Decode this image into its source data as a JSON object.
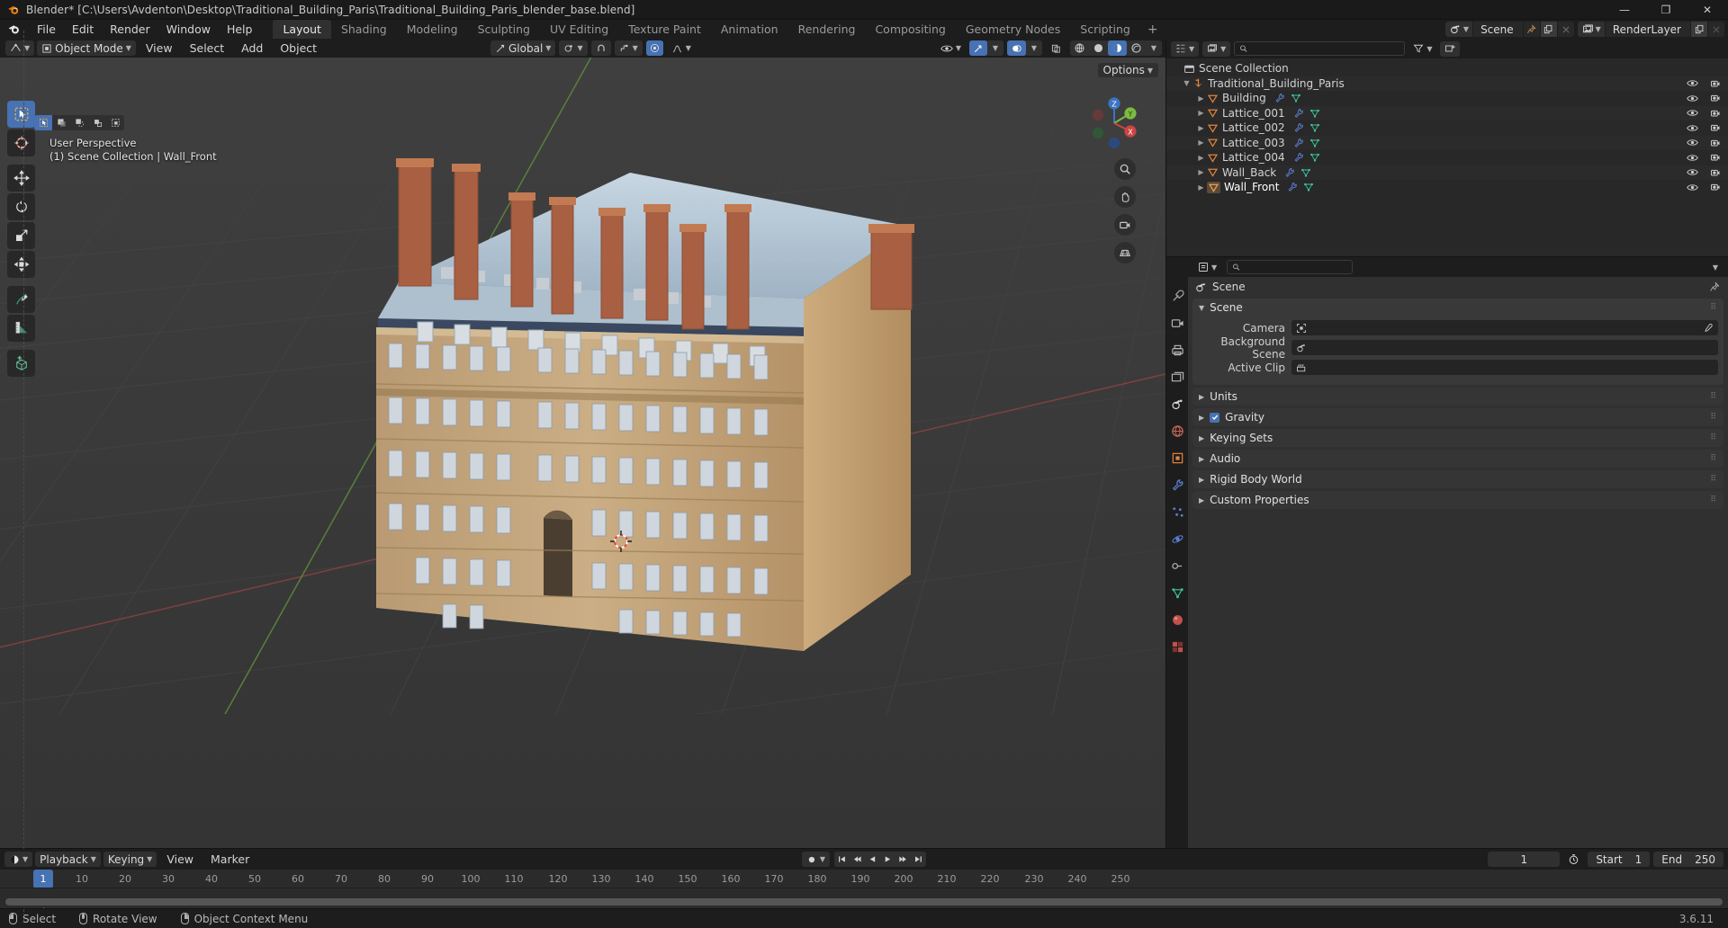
{
  "window": {
    "title": "Blender* [C:\\Users\\Avdenton\\Desktop\\Traditional_Building_Paris\\Traditional_Building_Paris_blender_base.blend]",
    "minimize": "—",
    "maximize": "❐",
    "close": "✕"
  },
  "menu": {
    "items": [
      "File",
      "Edit",
      "Render",
      "Window",
      "Help"
    ]
  },
  "workspace_tabs": {
    "items": [
      "Layout",
      "Shading",
      "Modeling",
      "Sculpting",
      "UV Editing",
      "Texture Paint",
      "Animation",
      "Rendering",
      "Compositing",
      "Geometry Nodes",
      "Scripting"
    ],
    "active": "Layout",
    "add_label": "+"
  },
  "topbar_right": {
    "scene_name": "Scene",
    "viewlayer_name": "RenderLayer"
  },
  "viewport_header": {
    "mode": "Object Mode",
    "menus": [
      "View",
      "Select",
      "Add",
      "Object"
    ],
    "transform_orientation": "Global",
    "options_label": "Options"
  },
  "viewport": {
    "overlay_line1": "User Perspective",
    "overlay_line2": "(1) Scene Collection | Wall_Front",
    "gizmo_axes": {
      "x": "X",
      "y": "Y",
      "z": "Z"
    }
  },
  "outliner": {
    "search_placeholder": "",
    "rows": [
      {
        "label": "Scene Collection",
        "depth": 0,
        "icon": "collection-icon",
        "expander": "",
        "has_mod_icons": false,
        "active": false
      },
      {
        "label": "Traditional_Building_Paris",
        "depth": 1,
        "icon": "collection-instance-icon",
        "expander": "▼",
        "has_mod_icons": false,
        "active": false
      },
      {
        "label": "Building",
        "depth": 2,
        "icon": "mesh-object-icon",
        "expander": "▶",
        "has_mod_icons": true,
        "active": false
      },
      {
        "label": "Lattice_001",
        "depth": 2,
        "icon": "mesh-object-icon",
        "expander": "▶",
        "has_mod_icons": true,
        "active": false
      },
      {
        "label": "Lattice_002",
        "depth": 2,
        "icon": "mesh-object-icon",
        "expander": "▶",
        "has_mod_icons": true,
        "active": false
      },
      {
        "label": "Lattice_003",
        "depth": 2,
        "icon": "mesh-object-icon",
        "expander": "▶",
        "has_mod_icons": true,
        "active": false
      },
      {
        "label": "Lattice_004",
        "depth": 2,
        "icon": "mesh-object-icon",
        "expander": "▶",
        "has_mod_icons": true,
        "active": false
      },
      {
        "label": "Wall_Back",
        "depth": 2,
        "icon": "mesh-object-icon",
        "expander": "▶",
        "has_mod_icons": true,
        "active": false
      },
      {
        "label": "Wall_Front",
        "depth": 2,
        "icon": "mesh-object-icon",
        "expander": "▶",
        "has_mod_icons": true,
        "active": true
      }
    ]
  },
  "properties": {
    "search_placeholder": "",
    "breadcrumb": "Scene",
    "scene_panel": {
      "title": "Scene",
      "rows": [
        {
          "label": "Camera",
          "value": "",
          "icon": "camera-icon",
          "has_eyedropper": true
        },
        {
          "label": "Background Scene",
          "value": "",
          "icon": "scene-icon",
          "has_eyedropper": false
        },
        {
          "label": "Active Clip",
          "value": "",
          "icon": "clip-icon",
          "has_eyedropper": false
        }
      ]
    },
    "closed_panels": [
      {
        "label": "Units",
        "checkbox": false
      },
      {
        "label": "Gravity",
        "checkbox": true
      },
      {
        "label": "Keying Sets",
        "checkbox": false
      },
      {
        "label": "Audio",
        "checkbox": false
      },
      {
        "label": "Rigid Body World",
        "checkbox": false
      },
      {
        "label": "Custom Properties",
        "checkbox": false
      }
    ]
  },
  "timeline": {
    "menus": [
      "Playback",
      "Keying",
      "View",
      "Marker"
    ],
    "current_frame": "1",
    "start_label": "Start",
    "start_value": "1",
    "end_label": "End",
    "end_value": "250",
    "ruler_ticks": [
      "1",
      "10",
      "20",
      "30",
      "40",
      "50",
      "60",
      "70",
      "80",
      "90",
      "100",
      "110",
      "120",
      "130",
      "140",
      "150",
      "160",
      "170",
      "180",
      "190",
      "200",
      "210",
      "220",
      "230",
      "240",
      "250"
    ],
    "playhead_frame": "1"
  },
  "statusbar": {
    "items": [
      {
        "label": "Select",
        "mouse": "left"
      },
      {
        "label": "Rotate View",
        "mouse": "middle"
      },
      {
        "label": "Object Context Menu",
        "mouse": "right"
      }
    ],
    "version": "3.6.11"
  },
  "colors": {
    "accent_blue": "#4772b3",
    "axis_x": "#cc4444",
    "axis_y": "#7cbb3f",
    "axis_z": "#3a74c4",
    "mesh_orange": "#e0843c",
    "bg_dark": "#1d1d1d",
    "panel": "#303030",
    "viewport_bg": "#393939"
  }
}
